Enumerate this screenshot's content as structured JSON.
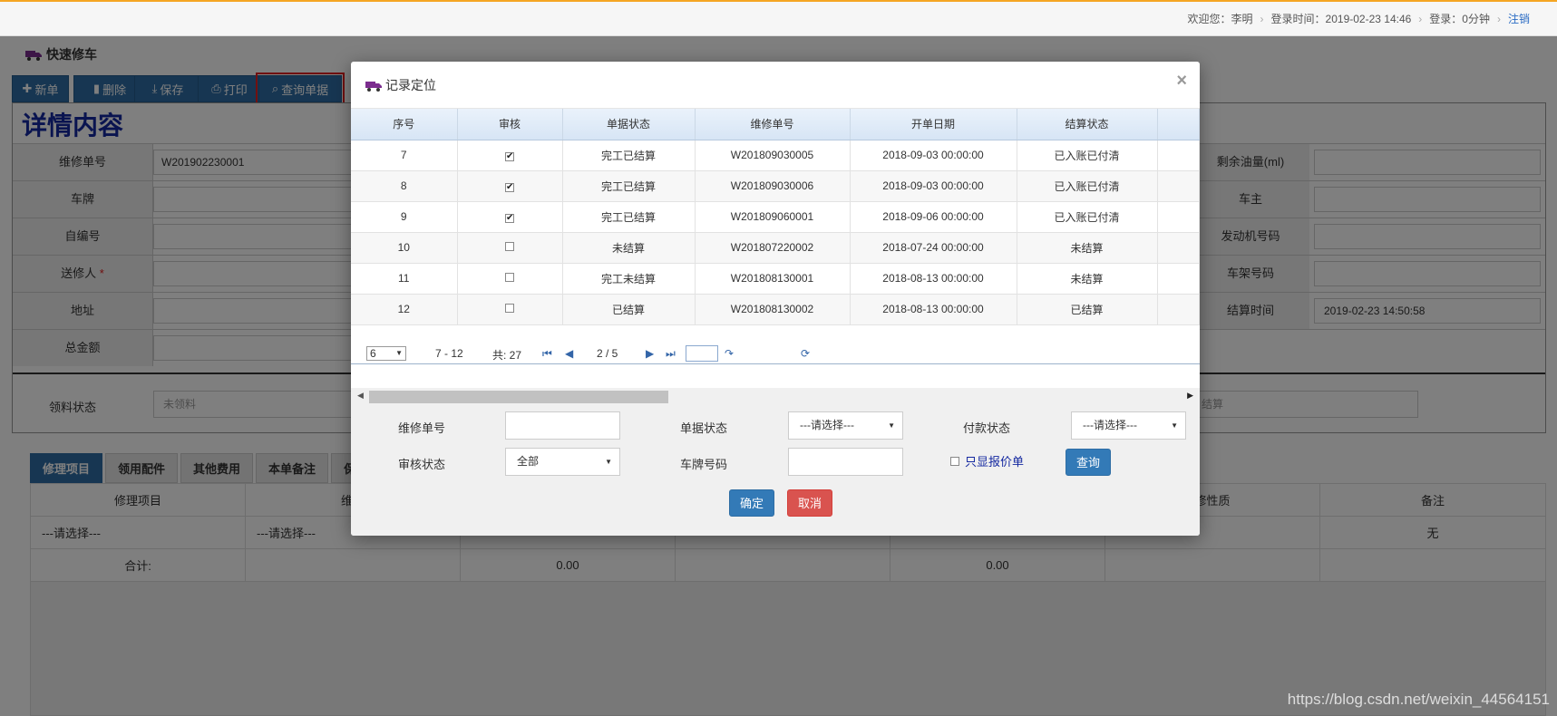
{
  "topbar": {
    "welcome": "欢迎您：李明",
    "login_time": "登录时间：2019-02-23 14:46",
    "login_duration": "登录：0分钟",
    "logout": "注销"
  },
  "page": {
    "title": "快速修车",
    "detail_title": "详情内容"
  },
  "toolbar": {
    "new": "新单",
    "delete": "删除",
    "save": "保存",
    "print": "打印",
    "query": "查询单据"
  },
  "form": {
    "repair_no_label": "维修单号",
    "repair_no_value": "W201902230001",
    "plate_label": "车牌",
    "self_no_label": "自编号",
    "sender_label": "送修人",
    "address_label": "地址",
    "total_label": "总金额",
    "fuel_label": "剩余油量(ml)",
    "owner_label": "车主",
    "engine_label": "发动机号码",
    "frame_label": "车架号码",
    "settle_time_label": "结算时间",
    "settle_time_value": "2019-02-23 14:50:58",
    "pick_status_label": "领料状态",
    "pick_status_value": "未领料",
    "settle_status_value": "结算"
  },
  "tabs": [
    "修理项目",
    "领用配件",
    "其他费用",
    "本单备注",
    "保"
  ],
  "grid": {
    "col1": "修理项目",
    "col2": "维修",
    "col_nature": "修性质",
    "col_remark": "备注",
    "select_placeholder": "---请选择---",
    "remark_value": "无",
    "total_label": "合计:",
    "total_1": "0.00",
    "total_2": "0.00"
  },
  "watermark": "https://blog.csdn.net/weixin_44564151",
  "modal": {
    "title": "记录定位",
    "close": "×",
    "columns": [
      "序号",
      "审核",
      "单据状态",
      "维修单号",
      "开单日期",
      "结算状态"
    ],
    "rows": [
      {
        "no": "7",
        "checked": true,
        "doc_status": "完工已结算",
        "repair_no": "W201809030005",
        "date": "2018-09-03 00:00:00",
        "settle": "已入账已付清"
      },
      {
        "no": "8",
        "checked": true,
        "doc_status": "完工已结算",
        "repair_no": "W201809030006",
        "date": "2018-09-03 00:00:00",
        "settle": "已入账已付清"
      },
      {
        "no": "9",
        "checked": true,
        "doc_status": "完工已结算",
        "repair_no": "W201809060001",
        "date": "2018-09-06 00:00:00",
        "settle": "已入账已付清"
      },
      {
        "no": "10",
        "checked": false,
        "doc_status": "未结算",
        "repair_no": "W201807220002",
        "date": "2018-07-24 00:00:00",
        "settle": "未结算"
      },
      {
        "no": "11",
        "checked": false,
        "doc_status": "完工未结算",
        "repair_no": "W201808130001",
        "date": "2018-08-13 00:00:00",
        "settle": "未结算"
      },
      {
        "no": "12",
        "checked": false,
        "doc_status": "已结算",
        "repair_no": "W201808130002",
        "date": "2018-08-13 00:00:00",
        "settle": "已结算"
      }
    ],
    "pager": {
      "page_size": "6",
      "range": "7 - 12",
      "total": "共: 27",
      "page": "2 / 5"
    },
    "filters": {
      "repair_no_label": "维修单号",
      "doc_status_label": "单据状态",
      "doc_status_value": "---请选择---",
      "pay_status_label": "付款状态",
      "pay_status_value": "---请选择---",
      "audit_label": "审核状态",
      "audit_value": "全部",
      "plate_label": "车牌号码",
      "quote_only": "只显报价单",
      "query": "查询"
    },
    "ok": "确定",
    "cancel": "取消"
  }
}
